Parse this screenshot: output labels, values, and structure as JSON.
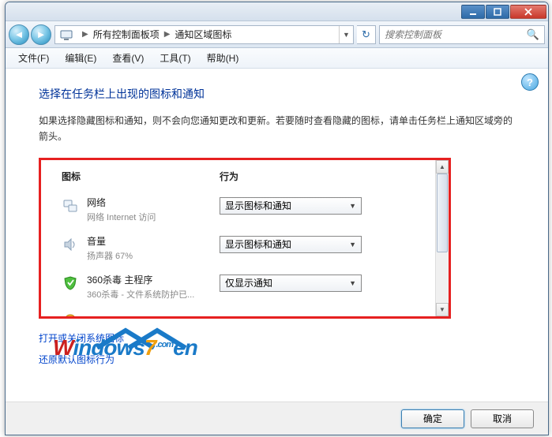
{
  "titlebar": {},
  "nav": {
    "breadcrumb1": "所有控制面板项",
    "breadcrumb2": "通知区域图标",
    "search_placeholder": "搜索控制面板"
  },
  "menu": {
    "file": "文件(F)",
    "edit": "编辑(E)",
    "view": "查看(V)",
    "tools": "工具(T)",
    "help": "帮助(H)"
  },
  "content": {
    "title": "选择在任务栏上出现的图标和通知",
    "desc": "如果选择隐藏图标和通知，则不会向您通知更改和更新。若要随时查看隐藏的图标，请单击任务栏上通知区域旁的箭头。",
    "col_icon": "图标",
    "col_behavior": "行为",
    "rows": [
      {
        "label": "网络",
        "sub": "网络 Internet 访问",
        "behavior": "显示图标和通知"
      },
      {
        "label": "音量",
        "sub": "扬声器 67%",
        "behavior": "显示图标和通知"
      },
      {
        "label": "360杀毒 主程序",
        "sub": "360杀毒 - 文件系统防护已...",
        "behavior": "仅显示通知"
      }
    ],
    "link1": "打开或关闭系统图标",
    "link2": "还原默认图标行为"
  },
  "footer": {
    "ok": "确定",
    "cancel": "取消"
  },
  "watermark": {
    "text_parts": [
      "W",
      "indows",
      "7",
      ".com",
      "en"
    ]
  }
}
